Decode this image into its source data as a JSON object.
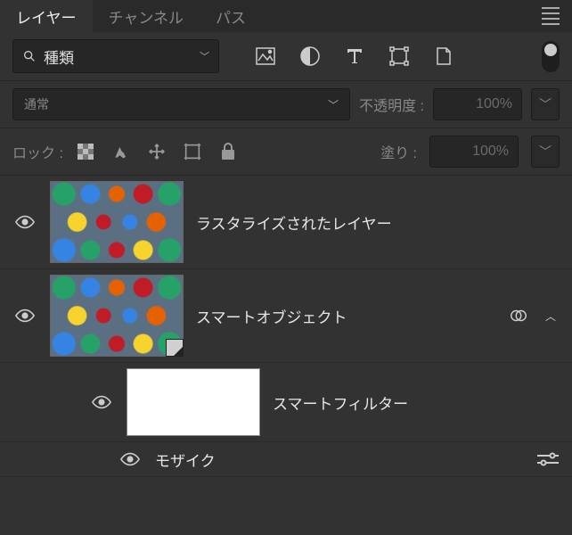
{
  "tabs": {
    "layers": "レイヤー",
    "channels": "チャンネル",
    "paths": "パス"
  },
  "search": {
    "placeholder": "種類"
  },
  "blend_mode": "通常",
  "opacity_label": "不透明度 :",
  "opacity_value": "100%",
  "lock_label": "ロック :",
  "fill_label": "塗り :",
  "fill_value": "100%",
  "layers": {
    "raster": "ラスタライズされたレイヤー",
    "smart_object": "スマートオブジェクト",
    "smart_filters_header": "スマートフィルター",
    "filter_mosaic": "モザイク"
  }
}
